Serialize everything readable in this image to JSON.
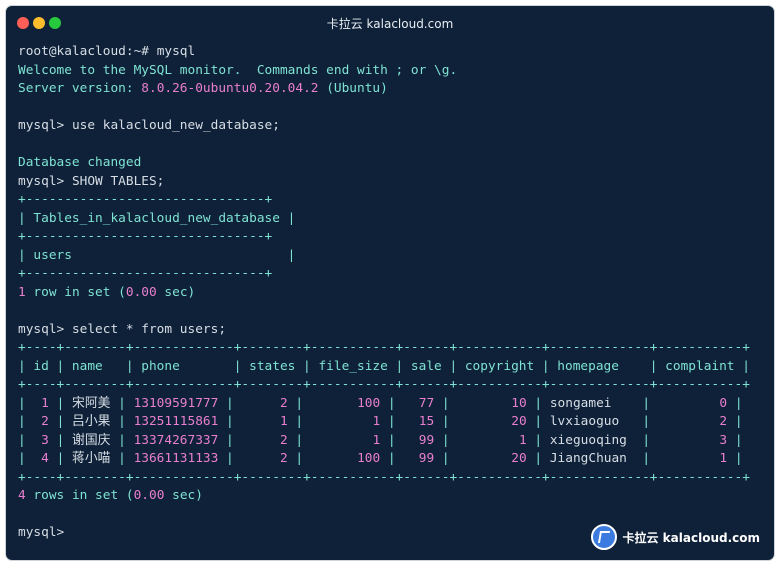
{
  "window": {
    "title": "卡拉云 kalacloud.com"
  },
  "terminal": {
    "prompt_root": "root@kalacloud:~# ",
    "cmd_mysql": "mysql",
    "welcome": "Welcome to the MySQL monitor.  Commands end with ; or \\g.",
    "server_label": "Server version: ",
    "server_version": "8.0.26-0ubuntu0.20.04.2",
    "server_os": " (Ubuntu)",
    "mysql_prompt": "mysql> ",
    "cmd_use": "use kalacloud_new_database;",
    "db_changed": "Database changed",
    "cmd_show": "SHOW TABLES;",
    "tables_border": "+-------------------------------+",
    "tables_header": "| Tables_in_kalacloud_new_database |",
    "tables_row": "| users                            |",
    "tables_result_count": "1",
    "tables_result_mid": " row in set (",
    "tables_result_time": "0.00",
    "tables_result_end": " sec)",
    "cmd_select": "select * from users;",
    "users_border": "+----+--------+-------------+--------+-----------+------+-----------+-------------+-----------+",
    "users_header": "| id | name   | phone       | states | file_size | sale | copyright | homepage    | complaint |",
    "rows": [
      {
        "id": "1",
        "name": "宋阿美",
        "phone": "13109591777",
        "states": "2",
        "file_size": "100",
        "sale": "77",
        "copyright": "10",
        "homepage": "songamei",
        "complaint": "0"
      },
      {
        "id": "2",
        "name": "吕小果",
        "phone": "13251115861",
        "states": "1",
        "file_size": "1",
        "sale": "15",
        "copyright": "20",
        "homepage": "lvxiaoguo",
        "complaint": "2"
      },
      {
        "id": "3",
        "name": "谢国庆",
        "phone": "13374267337",
        "states": "2",
        "file_size": "1",
        "sale": "99",
        "copyright": "1",
        "homepage": "xieguoqing",
        "complaint": "3"
      },
      {
        "id": "4",
        "name": "蒋小喵",
        "phone": "13661131133",
        "states": "2",
        "file_size": "100",
        "sale": "99",
        "copyright": "20",
        "homepage": "JiangChuan",
        "complaint": "1"
      }
    ],
    "users_result_count": "4",
    "users_result_mid": " rows in set (",
    "users_result_time": "0.00",
    "users_result_end": " sec)",
    "final_prompt": "mysql> "
  },
  "watermark": {
    "text": "卡拉云 kalacloud.com"
  }
}
